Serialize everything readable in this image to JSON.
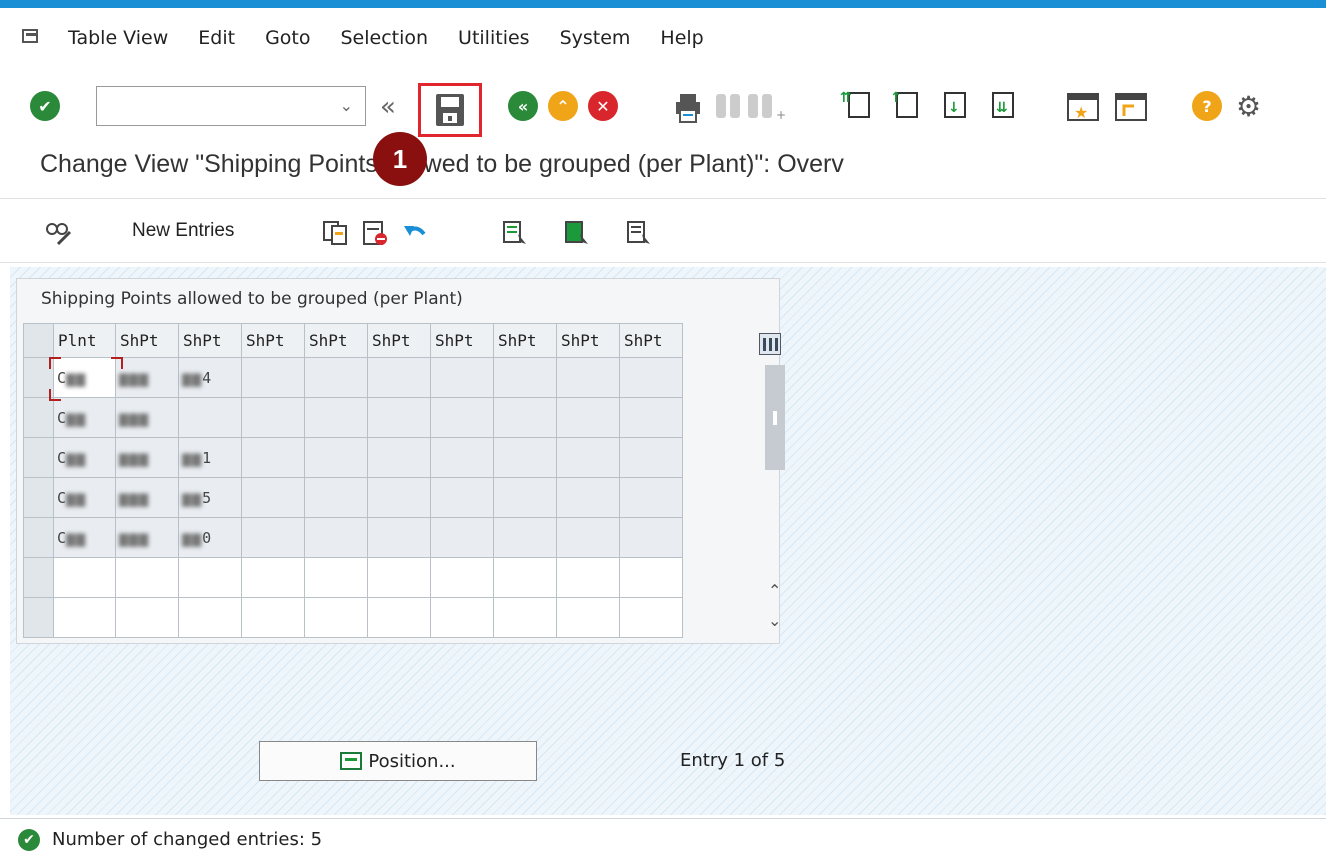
{
  "menubar": {
    "items": [
      {
        "label": "Table View",
        "u": "T"
      },
      {
        "label": "Edit",
        "u": "E"
      },
      {
        "label": "Goto",
        "u": "G"
      },
      {
        "label": "Selection",
        "u": ""
      },
      {
        "label": "Utilities",
        "u": ""
      },
      {
        "label": "System",
        "u": ""
      },
      {
        "label": "Help",
        "u": "H"
      }
    ],
    "labels": {
      "table_view": "Table View",
      "edit": "Edit",
      "goto": "Goto",
      "selection": "Selection",
      "utilities": "Utilities",
      "system": "System",
      "help": "Help"
    }
  },
  "toolbar": {
    "command_field": {
      "value": "",
      "placeholder": ""
    },
    "annotation_badge": "1",
    "icons": [
      "enter-icon",
      "back-arrows-icon",
      "save-icon",
      "back-icon",
      "exit-icon",
      "cancel-icon",
      "print-icon",
      "find-icon",
      "find-next-icon",
      "first-page-icon",
      "prev-page-icon",
      "next-page-icon",
      "last-page-icon",
      "create-session-icon",
      "shortcut-icon",
      "help-icon",
      "settings-icon"
    ]
  },
  "page": {
    "title": "Change View \"Shipping Points allowed to be grouped (per Plant)\": Overv"
  },
  "app_toolbar": {
    "new_entries": "New Entries",
    "icons": [
      "display-change-icon",
      "copy-icon",
      "delete-icon",
      "undo-icon",
      "select-all-icon",
      "select-block-icon",
      "deselect-all-icon"
    ]
  },
  "table": {
    "caption": "Shipping Points allowed to be grouped (per Plant)",
    "columns": [
      "Plnt",
      "ShPt",
      "ShPt",
      "ShPt",
      "ShPt",
      "ShPt",
      "ShPt",
      "ShPt",
      "ShPt",
      "ShPt"
    ],
    "rows": [
      [
        "C",
        "",
        "4"
      ],
      [
        "C",
        "",
        ""
      ],
      [
        "C",
        "",
        "1"
      ],
      [
        "C",
        "",
        "5"
      ],
      [
        "C",
        "",
        "0"
      ]
    ],
    "empty_rows": 2
  },
  "footer": {
    "position_button": "Position...",
    "entry_info": "Entry 1 of 5"
  },
  "status": {
    "message": "Number of changed entries: 5",
    "type": "success",
    "color": "#2a8a3a"
  },
  "colors": {
    "accent": "#1a8fd6",
    "highlight": "#e0262c",
    "badge": "#8a1010"
  }
}
